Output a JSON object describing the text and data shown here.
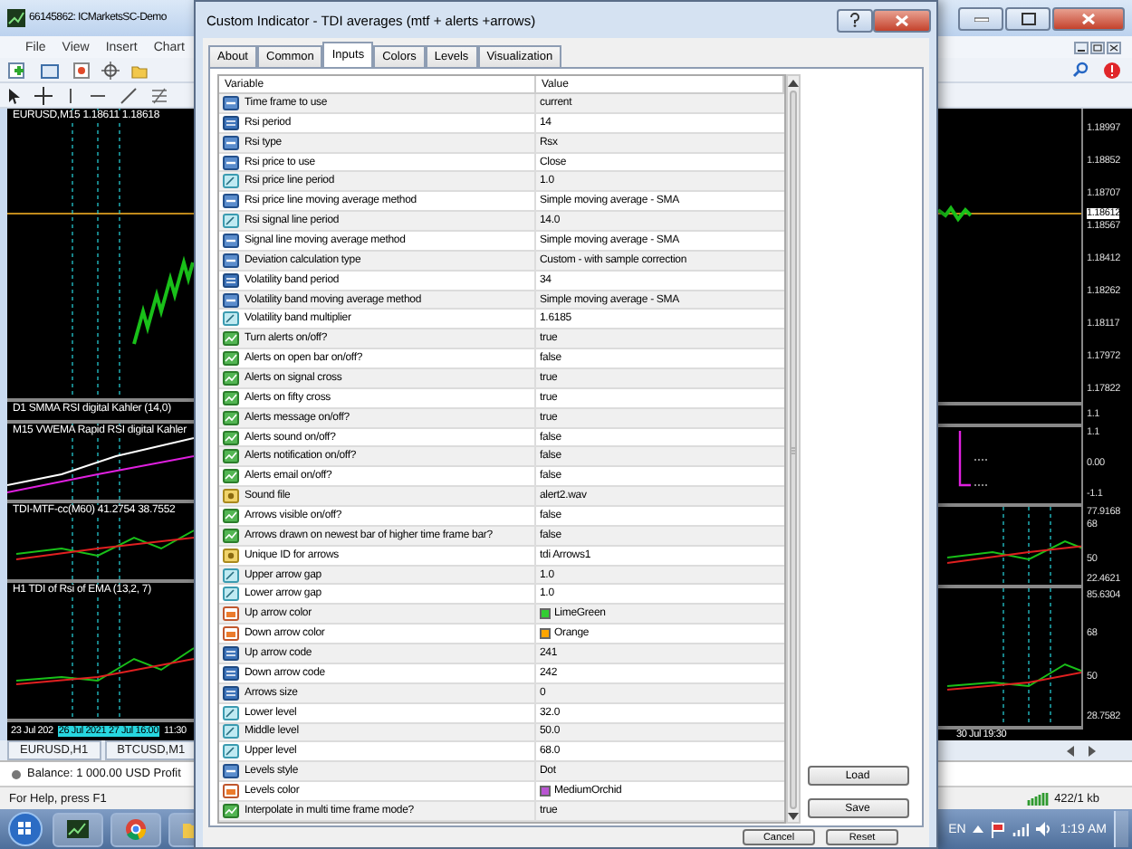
{
  "background_window": {
    "title": "66145862: ICMarketsSC-Demo",
    "menu": [
      "File",
      "View",
      "Insert",
      "Chart"
    ],
    "main_chart_label": "EURUSD,M15  1.18611 1.18618",
    "subwindow_labels": [
      "D1 SMMA RSI digital Kahler (14,0)",
      "M15 VWEMA Rapid RSI digital Kahler",
      "TDI-MTF-cc(M60) 41.2754 38.7552",
      "H1 TDI of Rsi of EMA (13,2, 7)"
    ],
    "date_axis_left": [
      {
        "label": "23 Jul 202",
        "kind": "plain"
      },
      {
        "label": "26 Jul 2021 27 Jul 16:00",
        "kind": "highlighted"
      },
      {
        "label": "11:30",
        "kind": "plain"
      }
    ],
    "price_axis": [
      {
        "label": "1.18997",
        "kind": "tick"
      },
      {
        "label": "1.18852",
        "kind": "tick"
      },
      {
        "label": "1.18707",
        "kind": "tick"
      },
      {
        "label": "1.18612",
        "kind": "current"
      },
      {
        "label": "1.18567",
        "kind": "tick"
      },
      {
        "label": "1.18412",
        "kind": "tick"
      },
      {
        "label": "1.18262",
        "kind": "tick"
      },
      {
        "label": "1.18117",
        "kind": "tick"
      },
      {
        "label": "1.17972",
        "kind": "tick"
      },
      {
        "label": "1.17822",
        "kind": "tick"
      }
    ],
    "subwindow_axes": [
      [
        "1.1"
      ],
      [
        "1.1",
        "0.00",
        "-1.1"
      ],
      [
        "77.9168",
        "68",
        "50",
        "22.4621"
      ],
      [
        "85.6304",
        "68",
        "50",
        "28.7582"
      ]
    ],
    "date_axis_right": "30 Jul 19:30",
    "chart_tabs": [
      {
        "label": "EURUSD,H1",
        "selected": false
      },
      {
        "label": "BTCUSD,M1",
        "selected": false
      }
    ],
    "balance": "Balance: 1 000.00 USD  Profit",
    "status": "For Help, press F1",
    "traffic": "422/1 kb"
  },
  "dialog": {
    "title": "Custom Indicator - TDI averages (mtf + alerts +arrows)",
    "tabs": [
      {
        "label": "About",
        "selected": false
      },
      {
        "label": "Common",
        "selected": false
      },
      {
        "label": "Inputs",
        "selected": true
      },
      {
        "label": "Colors",
        "selected": false
      },
      {
        "label": "Levels",
        "selected": false
      },
      {
        "label": "Visualization",
        "selected": false
      }
    ],
    "columns": [
      "Variable",
      "Value"
    ],
    "rows": [
      {
        "kind": "enum",
        "variable": "Time frame to use",
        "value": "current"
      },
      {
        "kind": "int",
        "variable": "Rsi period",
        "value": "14"
      },
      {
        "kind": "enum",
        "variable": "Rsi type",
        "value": "Rsx"
      },
      {
        "kind": "enum",
        "variable": "Rsi price to use",
        "value": "Close"
      },
      {
        "kind": "double",
        "variable": "Rsi price line period",
        "value": "1.0"
      },
      {
        "kind": "enum",
        "variable": "Rsi price line moving average method",
        "value": "Simple moving average - SMA"
      },
      {
        "kind": "double",
        "variable": "Rsi signal line period",
        "value": "14.0"
      },
      {
        "kind": "enum",
        "variable": "Signal line moving average method",
        "value": "Simple moving average - SMA"
      },
      {
        "kind": "enum",
        "variable": "Deviation calculation type",
        "value": "Custom - with sample correction"
      },
      {
        "kind": "int",
        "variable": "Volatility band period",
        "value": "34"
      },
      {
        "kind": "enum",
        "variable": "Volatility band moving average method",
        "value": "Simple moving average - SMA"
      },
      {
        "kind": "double",
        "variable": "Volatility band multiplier",
        "value": "1.6185"
      },
      {
        "kind": "bool",
        "variable": "Turn alerts on/off?",
        "value": "true"
      },
      {
        "kind": "bool",
        "variable": "Alerts on open bar on/off?",
        "value": "false"
      },
      {
        "kind": "bool",
        "variable": "Alerts on signal cross",
        "value": "true"
      },
      {
        "kind": "bool",
        "variable": "Alerts on fifty cross",
        "value": "true"
      },
      {
        "kind": "bool",
        "variable": "Alerts message on/off?",
        "value": "true"
      },
      {
        "kind": "bool",
        "variable": "Alerts sound on/off?",
        "value": "false"
      },
      {
        "kind": "bool",
        "variable": "Alerts notification on/off?",
        "value": "false"
      },
      {
        "kind": "bool",
        "variable": "Alerts email on/off?",
        "value": "false"
      },
      {
        "kind": "string",
        "variable": "Sound file",
        "value": "alert2.wav"
      },
      {
        "kind": "bool",
        "variable": "Arrows visible on/off?",
        "value": "false"
      },
      {
        "kind": "bool",
        "variable": "Arrows drawn on newest bar of higher time frame bar?",
        "value": "false"
      },
      {
        "kind": "string",
        "variable": "Unique ID for arrows",
        "value": "tdi Arrows1"
      },
      {
        "kind": "double",
        "variable": "Upper arrow gap",
        "value": "1.0"
      },
      {
        "kind": "double",
        "variable": "Lower arrow gap",
        "value": "1.0"
      },
      {
        "kind": "color",
        "variable": "Up arrow color",
        "value": "LimeGreen",
        "color": "#32cd32"
      },
      {
        "kind": "color",
        "variable": "Down arrow color",
        "value": "Orange",
        "color": "#ffa500"
      },
      {
        "kind": "int",
        "variable": "Up arrow code",
        "value": "241"
      },
      {
        "kind": "int",
        "variable": "Down arrow code",
        "value": "242"
      },
      {
        "kind": "int",
        "variable": "Arrows size",
        "value": "0"
      },
      {
        "kind": "double",
        "variable": "Lower level",
        "value": "32.0"
      },
      {
        "kind": "double",
        "variable": "Middle level",
        "value": "50.0"
      },
      {
        "kind": "double",
        "variable": "Upper level",
        "value": "68.0"
      },
      {
        "kind": "enum",
        "variable": "Levels style",
        "value": "Dot"
      },
      {
        "kind": "color",
        "variable": "Levels color",
        "value": "MediumOrchid",
        "color": "#ba55d3"
      },
      {
        "kind": "bool",
        "variable": "Interpolate in multi time frame mode?",
        "value": "true"
      }
    ],
    "side_buttons": [
      "Load",
      "Save"
    ],
    "bottom_buttons": [
      "Cancel",
      "Reset"
    ]
  },
  "taskbar": {
    "language": "EN",
    "time": "1:19 AM"
  }
}
